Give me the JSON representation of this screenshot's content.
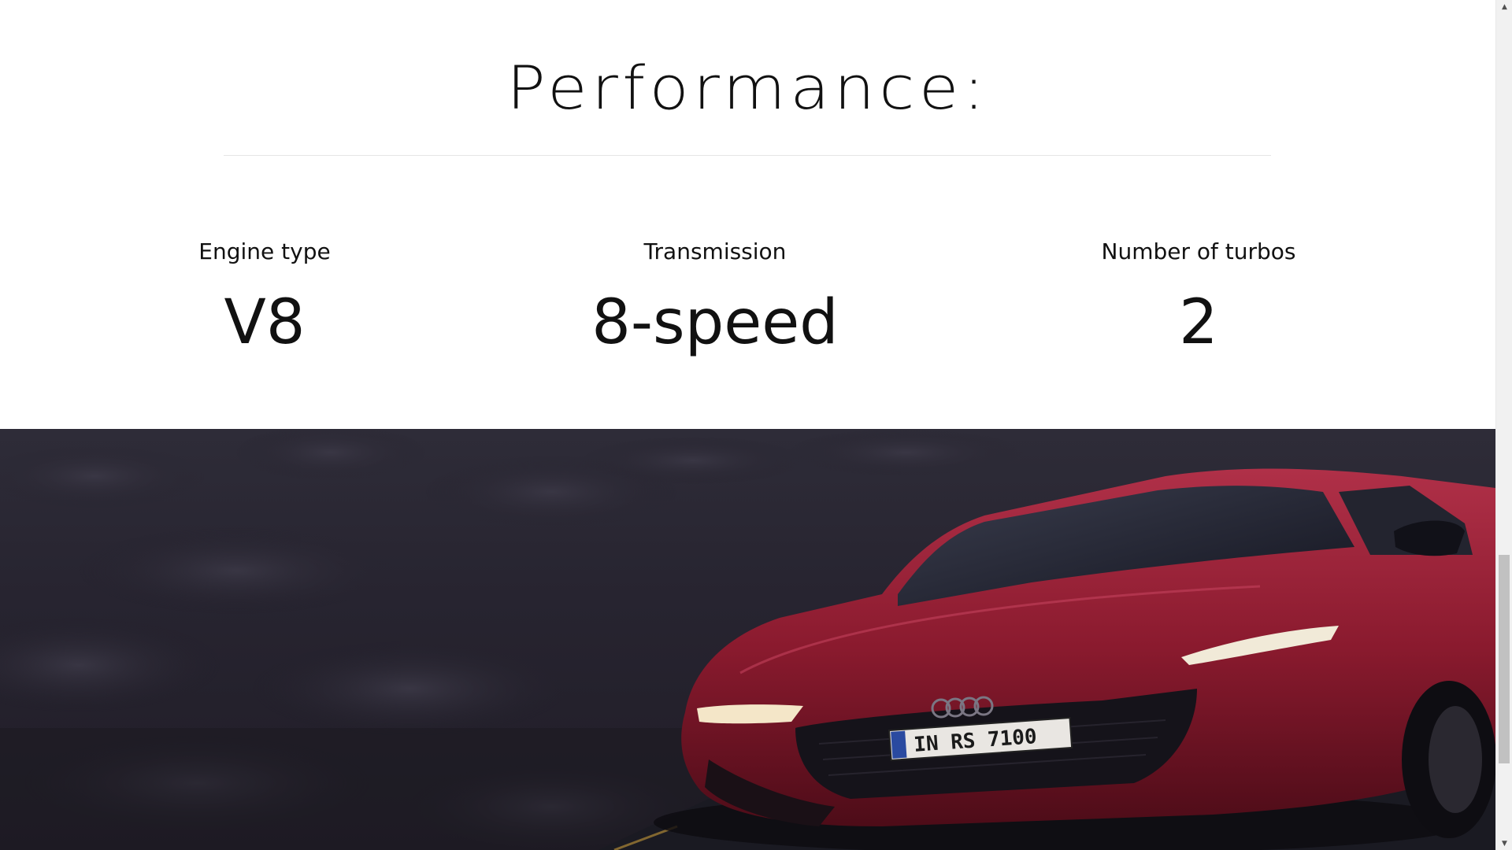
{
  "section": {
    "title": "Performance:"
  },
  "specs": [
    {
      "label": "Engine type",
      "value": "V8"
    },
    {
      "label": "Transmission",
      "value": "8-speed"
    },
    {
      "label": "Number of turbos",
      "value": "2"
    }
  ],
  "hero": {
    "image_name": "red-sports-car-photo",
    "license_plate": "IN RS 7100",
    "colors": {
      "car_body": "#8a1a2e",
      "background": "#272430"
    }
  },
  "scrollbar": {
    "up_icon": "triangle-up-icon",
    "down_icon": "triangle-down-icon",
    "up_glyph": "▲",
    "down_glyph": "▼",
    "position_fraction": 0.75
  }
}
